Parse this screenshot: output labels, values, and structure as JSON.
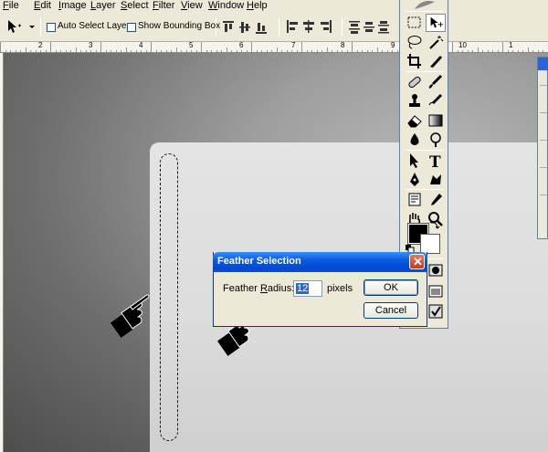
{
  "menu": [
    {
      "label": "File",
      "accel": "F",
      "rest": "ile"
    },
    {
      "label": "Edit",
      "accel": "E",
      "rest": "dit"
    },
    {
      "label": "Image",
      "accel": "I",
      "rest": "mage"
    },
    {
      "label": "Layer",
      "accel": "L",
      "rest": "ayer"
    },
    {
      "label": "Select",
      "accel": "S",
      "rest": "elect"
    },
    {
      "label": "Filter",
      "accel": "F",
      "rest": "ilter"
    },
    {
      "label": "View",
      "accel": "V",
      "rest": "iew"
    },
    {
      "label": "Window",
      "accel": "W",
      "rest": "indow"
    },
    {
      "label": "Help",
      "accel": "H",
      "rest": "elp"
    }
  ],
  "options": {
    "auto_select_label": "Auto Select Layer",
    "bounding_box_label": "Show Bounding Box",
    "auto_select_checked": false,
    "bounding_box_checked": false
  },
  "ruler": {
    "labels": [
      "2",
      "3",
      "4",
      "5",
      "6",
      "7",
      "8",
      "9",
      "10",
      "1"
    ]
  },
  "dialog": {
    "title": "Feather Selection",
    "field_label_pre": "Feather ",
    "field_label_accel": "R",
    "field_label_post": "adius:",
    "value": "12",
    "unit": "pixels",
    "ok_label": "OK",
    "cancel_label": "Cancel"
  },
  "toolbox": {
    "foreground_color": "#000000",
    "background_color": "#ffffff"
  },
  "colors": {
    "titlebar": "#0a5ce0",
    "chrome": "#ece9d8",
    "selection_highlight": "#316ac5"
  }
}
